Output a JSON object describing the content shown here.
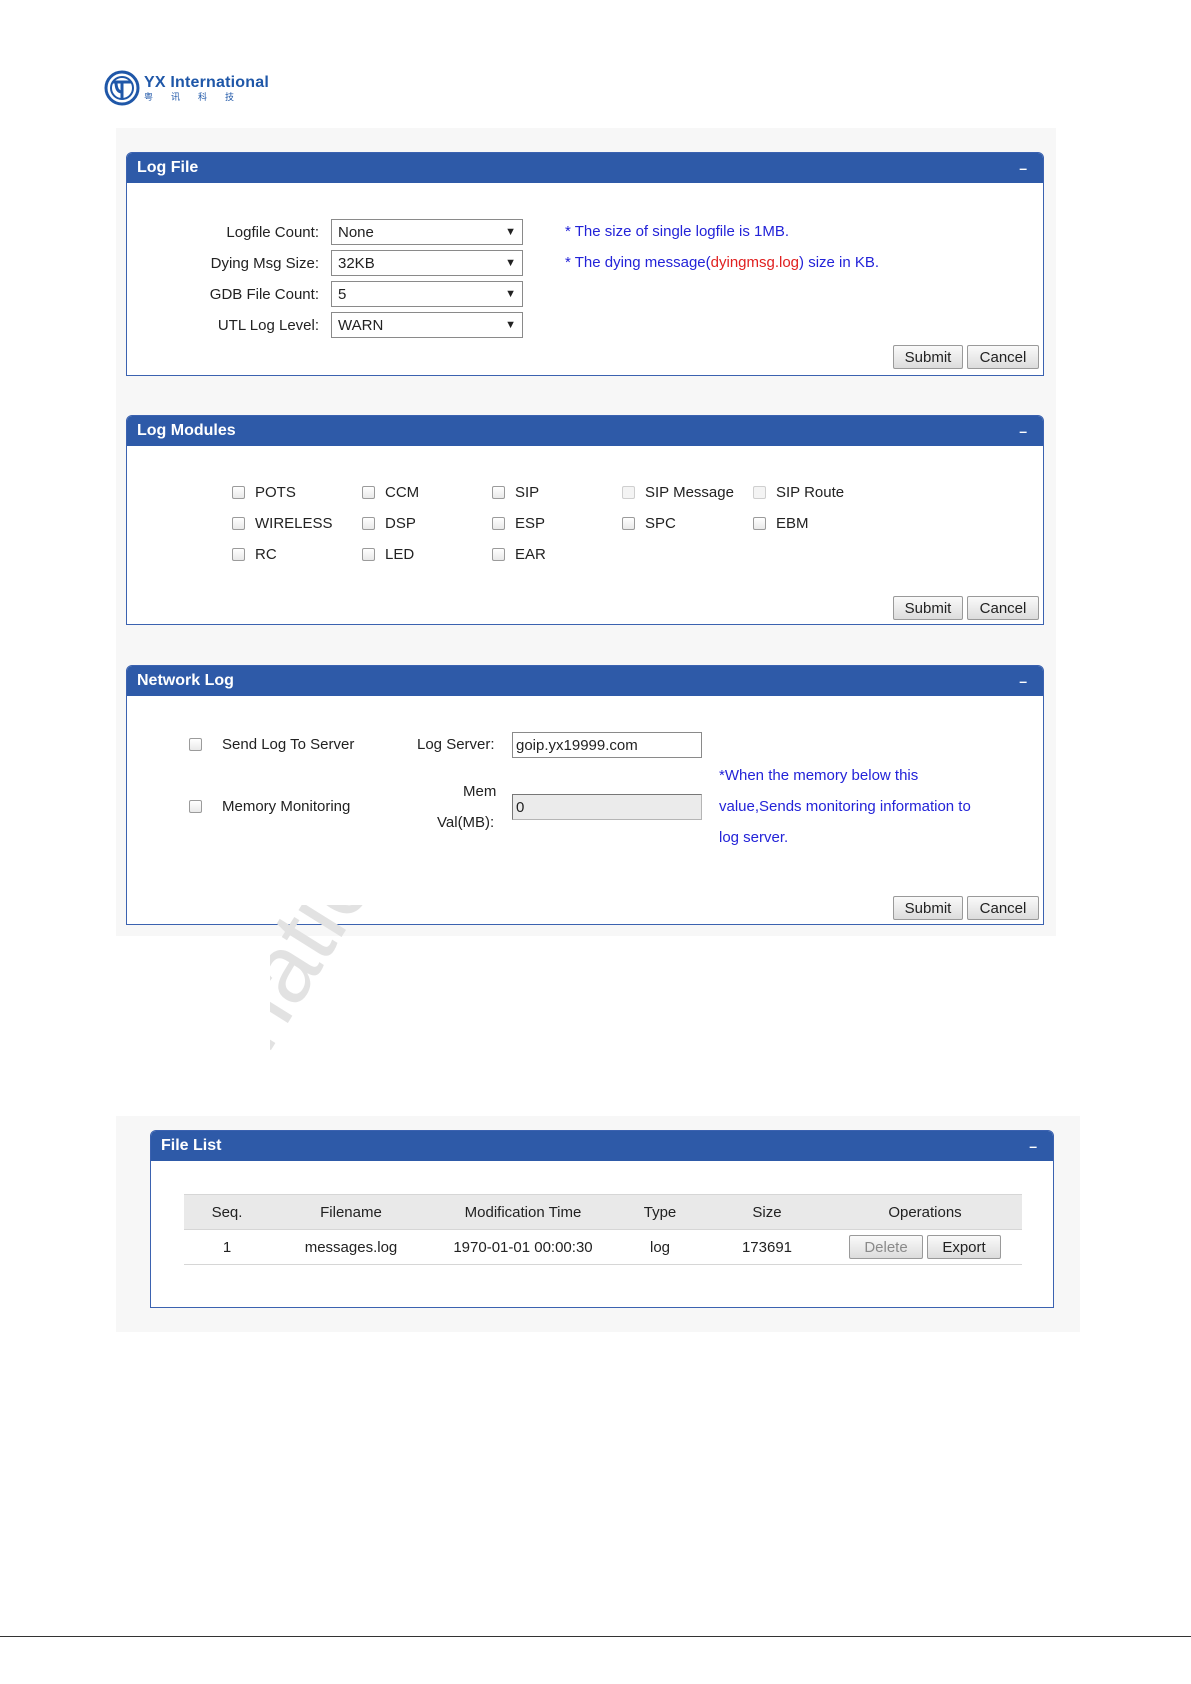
{
  "brand": {
    "name": "YX International",
    "subtitle": "粤讯科技",
    "logo_icon": "yx-globe-logo"
  },
  "watermark": {
    "text": "rnational"
  },
  "log_file": {
    "title": "Log File",
    "collapse": "–",
    "fields": [
      {
        "label": "Logfile Count:",
        "value": "None"
      },
      {
        "label": "Dying Msg Size:",
        "value": "32KB"
      },
      {
        "label": "GDB File Count:",
        "value": "5"
      },
      {
        "label": "UTL Log Level:",
        "value": "WARN"
      }
    ],
    "note1": "* The size of single logfile is 1MB.",
    "note2_prefix": "* The dying message(",
    "note2_red": "dyingmsg.log",
    "note2_suffix": ") size in KB.",
    "submit": "Submit",
    "cancel": "Cancel"
  },
  "log_modules": {
    "title": "Log Modules",
    "collapse": "–",
    "items": [
      "POTS",
      "CCM",
      "SIP",
      "SIP Message",
      "SIP Route",
      "WIRELESS",
      "DSP",
      "ESP",
      "SPC",
      "EBM",
      "RC",
      "LED",
      "EAR"
    ],
    "submit": "Submit",
    "cancel": "Cancel"
  },
  "network_log": {
    "title": "Network Log",
    "collapse": "–",
    "send_log": "Send Log To Server",
    "log_server_label": "Log Server:",
    "log_server_value": "goip.yx19999.com",
    "memory_monitoring": "Memory Monitoring",
    "mem_label_1": "Mem",
    "mem_label_2": "Val(MB):",
    "mem_value": "0",
    "note_1": "*When the memory below this",
    "note_2": "value,Sends monitoring information to",
    "note_3": "log server.",
    "submit": "Submit",
    "cancel": "Cancel"
  },
  "file_list": {
    "title": "File List",
    "collapse": "–",
    "headers": [
      "Seq.",
      "Filename",
      "Modification Time",
      "Type",
      "Size",
      "Operations"
    ],
    "rows": [
      {
        "seq": "1",
        "filename": "messages.log",
        "mtime": "1970-01-01 00:00:30",
        "type": "log",
        "size": "173691"
      }
    ],
    "delete": "Delete",
    "export": "Export"
  },
  "colors": {
    "header_blue": "#2e5aa8",
    "note_blue": "#2323d8",
    "note_red": "#e02020"
  }
}
